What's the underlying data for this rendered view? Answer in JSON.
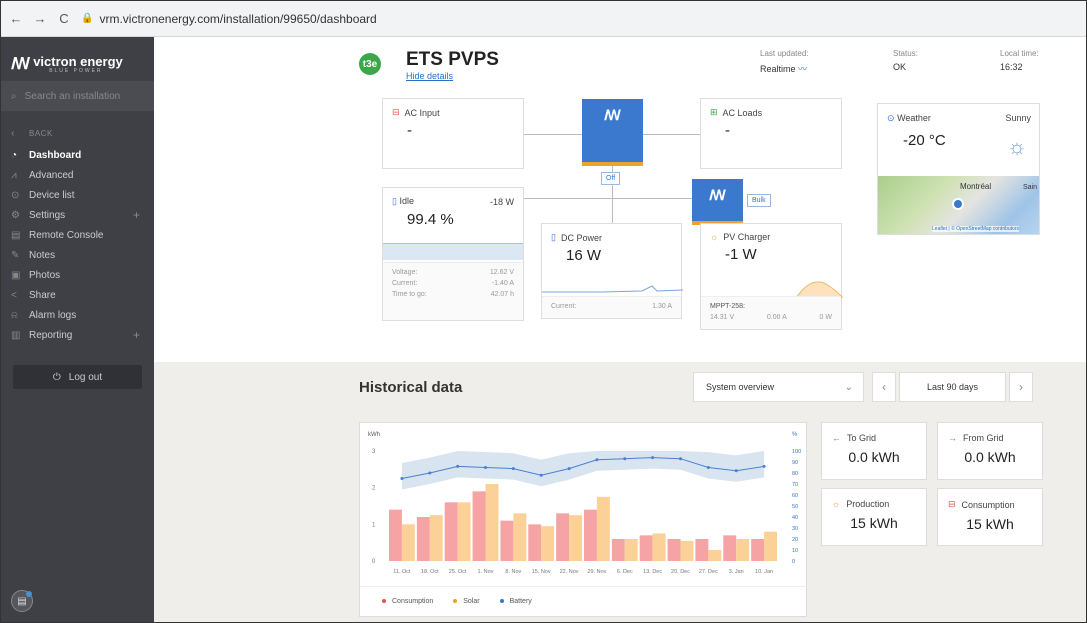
{
  "browser": {
    "url": "vrm.victronenergy.com/installation/99650/dashboard"
  },
  "sidebar": {
    "brand": "victron energy",
    "brand_sub": "BLUE POWER",
    "search_placeholder": "Search an installation",
    "back": "BACK",
    "items": [
      {
        "label": "Dashboard",
        "icon": "gauge-icon"
      },
      {
        "label": "Advanced",
        "icon": "chart-icon"
      },
      {
        "label": "Device list",
        "icon": "pin-icon"
      },
      {
        "label": "Settings",
        "icon": "gear-icon"
      },
      {
        "label": "Remote Console",
        "icon": "console-icon"
      },
      {
        "label": "Notes",
        "icon": "note-icon"
      },
      {
        "label": "Photos",
        "icon": "photo-icon"
      },
      {
        "label": "Share",
        "icon": "share-icon"
      },
      {
        "label": "Alarm logs",
        "icon": "alarm-icon"
      },
      {
        "label": "Reporting",
        "icon": "report-icon"
      }
    ],
    "logout": "Log out"
  },
  "header": {
    "logo_text": "t3e",
    "title": "ETS PVPS",
    "hide_details": "Hide details",
    "last_updated_label": "Last updated:",
    "last_updated_value": "Realtime",
    "status_label": "Status:",
    "status_value": "OK",
    "local_time_label": "Local time:",
    "local_time_value": "16:32"
  },
  "overview": {
    "ac_input": {
      "title": "AC Input",
      "value": "-"
    },
    "ac_loads": {
      "title": "AC Loads",
      "value": "-"
    },
    "inverter_state": "Off",
    "charger_state": "Bulk",
    "battery": {
      "title": "Idle",
      "power": "-18 W",
      "soc": "99.4 %",
      "voltage_label": "Voltage:",
      "voltage": "12.62 V",
      "current_label": "Current:",
      "current": "-1.40 A",
      "ttg_label": "Time to go:",
      "ttg": "42.07 h"
    },
    "dc_power": {
      "title": "DC Power",
      "value": "16 W",
      "current_label": "Current:",
      "current": "1.30 A"
    },
    "pv_charger": {
      "title": "PV Charger",
      "value": "-1 W",
      "model": "MPPT-258:",
      "v": "14.31 V",
      "a": "0.00 A",
      "w": "0 W"
    }
  },
  "weather": {
    "title": "Weather",
    "condition": "Sunny",
    "temp": "-20 °C",
    "map_label": "Montréal",
    "map_label_right": "Sain",
    "attribution": "Leaflet | © OpenStreetMap contributors"
  },
  "historical": {
    "title": "Historical data",
    "select": "System overview",
    "range": "Last 90 days"
  },
  "summary": {
    "to_grid_label": "To Grid",
    "to_grid": "0.0 kWh",
    "from_grid_label": "From Grid",
    "from_grid": "0.0 kWh",
    "production_label": "Production",
    "production": "15 kWh",
    "consumption_label": "Consumption",
    "consumption": "15 kWh"
  },
  "chart_data": {
    "type": "bar",
    "ylabel": "kWh",
    "y2label": "%",
    "ylim": [
      0,
      3
    ],
    "y2lim": [
      0,
      100
    ],
    "yticks": [
      0,
      1,
      2,
      3
    ],
    "y2ticks": [
      0,
      10,
      20,
      30,
      40,
      50,
      60,
      70,
      80,
      90,
      100
    ],
    "xticklabels": [
      "11. Oct",
      "18. Oct",
      "25. Oct",
      "1. Nov",
      "8. Nov",
      "15. Nov",
      "22. Nov",
      "29. Nov",
      "6. Dec",
      "13. Dec",
      "20. Dec",
      "27. Dec",
      "3. Jan",
      "10. Jan"
    ],
    "colors": {
      "Consumption": "#f6a3a6",
      "Solar": "#fcd198",
      "Battery": "#4a7fd0",
      "band": "#c7d8ea"
    },
    "series": [
      {
        "name": "Consumption",
        "values": [
          1.4,
          1.2,
          1.6,
          1.9,
          1.1,
          1.0,
          1.3,
          1.4,
          0.6,
          0.7,
          0.6,
          0.6,
          0.7,
          0.6
        ]
      },
      {
        "name": "Solar",
        "values": [
          1.0,
          1.25,
          1.6,
          2.1,
          1.3,
          0.95,
          1.25,
          1.75,
          0.6,
          0.75,
          0.55,
          0.3,
          0.6,
          0.8
        ]
      },
      {
        "name": "Battery",
        "values": [
          75,
          80,
          86,
          85,
          84,
          78,
          84,
          92,
          93,
          94,
          93,
          85,
          82,
          86
        ]
      }
    ],
    "legend": [
      "Consumption",
      "Solar",
      "Battery"
    ]
  }
}
